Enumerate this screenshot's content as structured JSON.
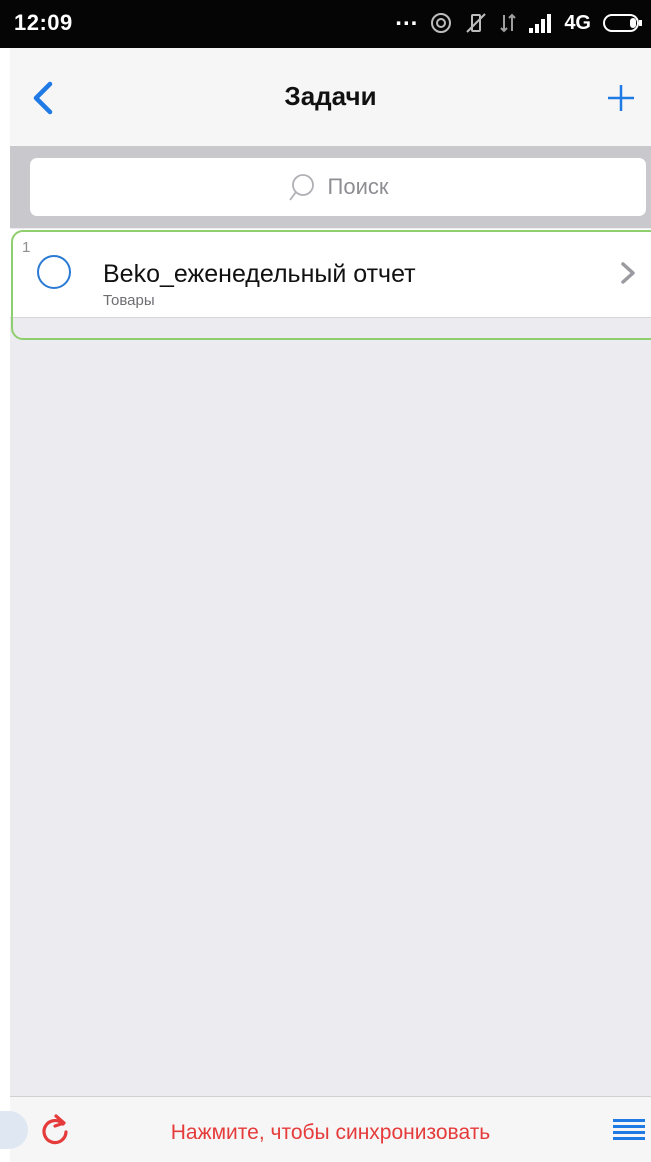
{
  "status_bar": {
    "time": "12:09",
    "dots": "...",
    "network": "4G"
  },
  "nav": {
    "title": "Задачи",
    "back_icon": "chevron-left-icon",
    "add_icon": "plus-icon"
  },
  "search": {
    "placeholder": "Поиск"
  },
  "tasks": [
    {
      "number": "1",
      "title": "Beko_еженедельный отчет",
      "subtitle": "Товары"
    }
  ],
  "bottom_bar": {
    "sync_label": "Нажмите, чтобы синхронизовать",
    "refresh_icon": "refresh-icon",
    "menu_icon": "menu-icon"
  },
  "colors": {
    "accent": "#2a7ad5",
    "sync_text": "#e53b3b",
    "selection_outline": "#8fce6e"
  }
}
